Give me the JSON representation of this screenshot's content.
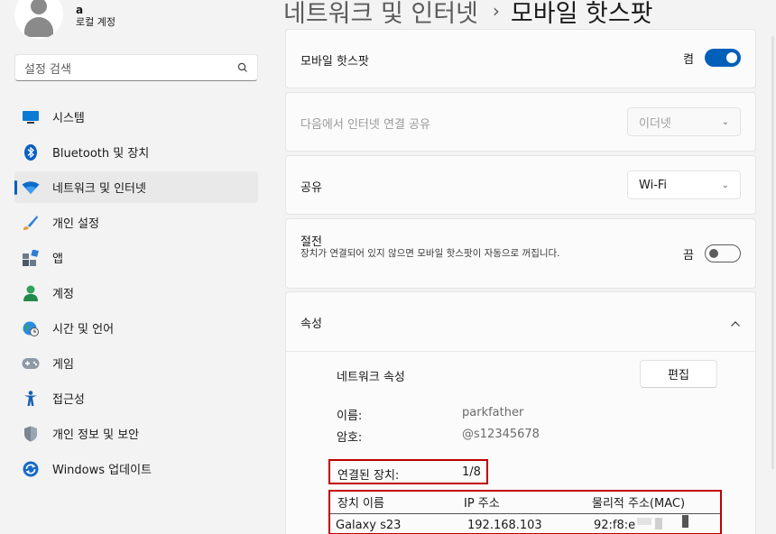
{
  "user": {
    "name": "a",
    "account_type": "로컬 계정"
  },
  "search": {
    "placeholder": "설정 검색"
  },
  "nav": [
    {
      "label": "시스템",
      "icon": "system-icon"
    },
    {
      "label": "Bluetooth 및 장치",
      "icon": "bluetooth-icon"
    },
    {
      "label": "네트워크 및 인터넷",
      "icon": "wifi-icon",
      "active": true
    },
    {
      "label": "개인 설정",
      "icon": "brush-icon"
    },
    {
      "label": "앱",
      "icon": "apps-icon"
    },
    {
      "label": "계정",
      "icon": "account-icon"
    },
    {
      "label": "시간 및 언어",
      "icon": "globe-clock-icon"
    },
    {
      "label": "게임",
      "icon": "gamepad-icon"
    },
    {
      "label": "접근성",
      "icon": "accessibility-icon"
    },
    {
      "label": "개인 정보 및 보안",
      "icon": "shield-icon"
    },
    {
      "label": "Windows 업데이트",
      "icon": "update-icon"
    }
  ],
  "breadcrumb": {
    "parent": "네트워크 및 인터넷",
    "separator": "›",
    "current": "모바일 핫스팟"
  },
  "hotspot": {
    "label": "모바일 핫스팟",
    "state_label": "켬",
    "on": true
  },
  "share_from": {
    "label": "다음에서 인터넷 연결 공유",
    "value": "이더넷",
    "disabled": true
  },
  "share_over": {
    "label": "공유",
    "value": "Wi-Fi"
  },
  "power_saving": {
    "title": "절전",
    "description": "장치가 연결되어 있지 않으면 모바일 핫스팟이 자동으로 꺼집니다.",
    "state_label": "끔",
    "on": false
  },
  "properties": {
    "header": "속성",
    "network_props_label": "네트워크 속성",
    "edit_label": "편집",
    "name_label": "이름:",
    "name_value": "parkfather",
    "password_label": "암호:",
    "password_value": "@s12345678",
    "connected_label": "연결된 장치:",
    "connected_value": "1/8",
    "table_headers": [
      "장치 이름",
      "IP 주소",
      "물리적 주소(MAC)"
    ],
    "devices": [
      {
        "name": "Galaxy s23",
        "ip": "192.168.103",
        "mac": "92:f8:e"
      }
    ]
  },
  "colors": {
    "accent": "#005fb8",
    "highlight_border": "#c00000",
    "background": "#f3f3f3",
    "card": "#fbfbfb"
  }
}
